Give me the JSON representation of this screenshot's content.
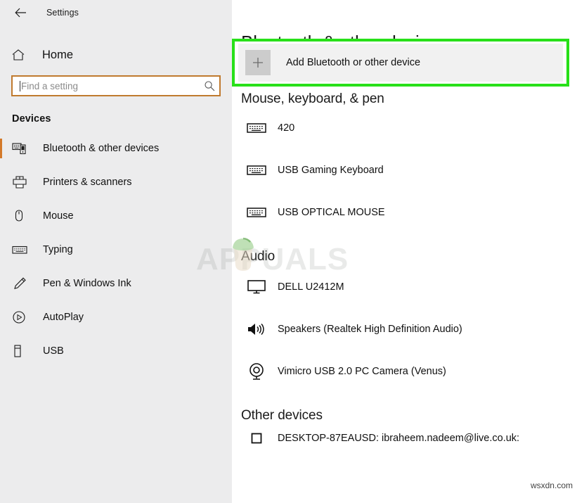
{
  "window": {
    "title": "Settings",
    "back_icon": "back-arrow-icon"
  },
  "sidebar": {
    "home": {
      "label": "Home",
      "icon": "home-icon"
    },
    "search": {
      "value": "",
      "placeholder": "Find a setting",
      "icon": "search-icon"
    },
    "category": "Devices",
    "items": [
      {
        "label": "Bluetooth & other devices",
        "icon": "bluetooth-devices-icon",
        "active": true
      },
      {
        "label": "Printers & scanners",
        "icon": "printer-icon",
        "active": false
      },
      {
        "label": "Mouse",
        "icon": "mouse-icon",
        "active": false
      },
      {
        "label": "Typing",
        "icon": "keyboard-icon",
        "active": false
      },
      {
        "label": "Pen & Windows Ink",
        "icon": "pen-icon",
        "active": false
      },
      {
        "label": "AutoPlay",
        "icon": "autoplay-icon",
        "active": false
      },
      {
        "label": "USB",
        "icon": "usb-icon",
        "active": false
      }
    ]
  },
  "main": {
    "page_title": "Bluetooth & other devices",
    "add_device": {
      "label": "Add Bluetooth or other device",
      "icon": "plus-icon"
    },
    "groups": [
      {
        "title": "Mouse, keyboard, & pen",
        "devices": [
          {
            "label": "420",
            "icon": "keyboard-icon"
          },
          {
            "label": "USB Gaming Keyboard",
            "icon": "keyboard-icon"
          },
          {
            "label": "USB OPTICAL MOUSE",
            "icon": "keyboard-icon"
          }
        ]
      },
      {
        "title": "Audio",
        "devices": [
          {
            "label": "DELL U2412M",
            "icon": "monitor-icon"
          },
          {
            "label": "Speakers (Realtek High Definition Audio)",
            "icon": "speaker-icon"
          },
          {
            "label": "Vimicro USB 2.0 PC Camera (Venus)",
            "icon": "webcam-icon"
          }
        ]
      },
      {
        "title": "Other devices",
        "devices": [
          {
            "label": "DESKTOP-87EAUSD: ibraheem.nadeem@live.co.uk:",
            "icon": "checkbox-icon"
          }
        ]
      }
    ]
  },
  "annotation": {
    "highlight_color": "#28e019",
    "accent_color": "#d3792a",
    "search_border_color": "#c07a2e"
  },
  "watermarks": {
    "center": "APPUALS",
    "corner": "wsxdn.com"
  }
}
